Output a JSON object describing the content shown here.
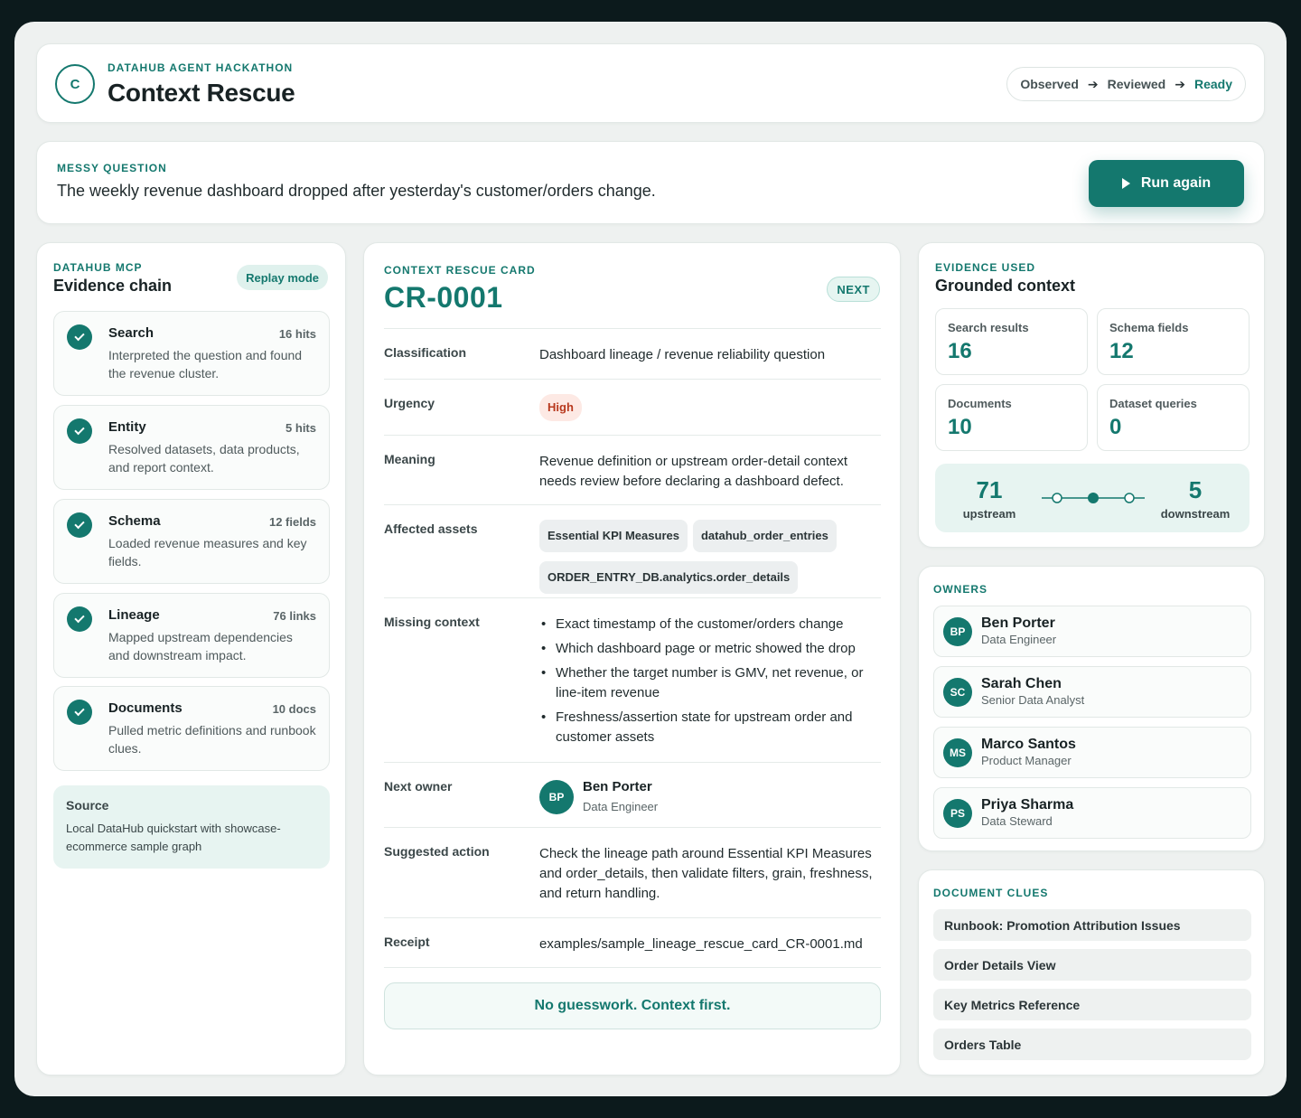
{
  "header": {
    "logo_letter": "C",
    "eyebrow": "DATAHUB AGENT HACKATHON",
    "title": "Context Rescue",
    "steps": [
      "Observed",
      "Reviewed",
      "Ready"
    ]
  },
  "question": {
    "eyebrow": "MESSY QUESTION",
    "text": "The weekly revenue dashboard dropped after yesterday's customer/orders change.",
    "run_label": "Run again"
  },
  "evidence_chain": {
    "eyebrow": "DATAHUB MCP",
    "title": "Evidence chain",
    "mode_label": "Replay mode",
    "items": [
      {
        "name": "Search",
        "count": "16 hits",
        "desc": "Interpreted the question and found the revenue cluster."
      },
      {
        "name": "Entity",
        "count": "5 hits",
        "desc": "Resolved datasets, data products, and report context."
      },
      {
        "name": "Schema",
        "count": "12 fields",
        "desc": "Loaded revenue measures and key fields."
      },
      {
        "name": "Lineage",
        "count": "76 links",
        "desc": "Mapped upstream dependencies and downstream impact."
      },
      {
        "name": "Documents",
        "count": "10 docs",
        "desc": "Pulled metric definitions and runbook clues."
      }
    ],
    "source_title": "Source",
    "source_text": "Local DataHub quickstart with showcase-ecommerce sample graph"
  },
  "rescue_card": {
    "eyebrow": "CONTEXT RESCUE CARD",
    "id": "CR-0001",
    "badge": "NEXT",
    "classification_label": "Classification",
    "classification": "Dashboard lineage / revenue reliability question",
    "urgency_label": "Urgency",
    "urgency": "High",
    "meaning_label": "Meaning",
    "meaning": "Revenue definition or upstream order-detail context needs review before declaring a dashboard defect.",
    "assets_label": "Affected assets",
    "assets": [
      "Essential KPI Measures",
      "datahub_order_entries",
      "ORDER_ENTRY_DB.analytics.order_details"
    ],
    "missing_label": "Missing context",
    "missing": [
      "Exact timestamp of the customer/orders change",
      "Which dashboard page or metric showed the drop",
      "Whether the target number is GMV, net revenue, or line-item revenue",
      "Freshness/assertion state for upstream order and customer assets"
    ],
    "owner_label": "Next owner",
    "owner": {
      "initials": "BP",
      "name": "Ben Porter",
      "role": "Data Engineer"
    },
    "action_label": "Suggested action",
    "action": "Check the lineage path around Essential KPI Measures and order_details, then validate filters, grain, freshness, and return handling.",
    "receipt_label": "Receipt",
    "receipt": "examples/sample_lineage_rescue_card_CR-0001.md",
    "banner": "No guesswork. Context first."
  },
  "evidence_used": {
    "eyebrow": "EVIDENCE USED",
    "title": "Grounded context",
    "stats": [
      {
        "label": "Search results",
        "value": "16"
      },
      {
        "label": "Schema fields",
        "value": "12"
      },
      {
        "label": "Documents",
        "value": "10"
      },
      {
        "label": "Dataset queries",
        "value": "0"
      }
    ],
    "upstream_value": "71",
    "upstream_label": "upstream",
    "downstream_value": "5",
    "downstream_label": "downstream"
  },
  "owners": {
    "eyebrow": "OWNERS",
    "list": [
      {
        "initials": "BP",
        "name": "Ben Porter",
        "role": "Data Engineer"
      },
      {
        "initials": "SC",
        "name": "Sarah Chen",
        "role": "Senior Data Analyst"
      },
      {
        "initials": "MS",
        "name": "Marco Santos",
        "role": "Product Manager"
      },
      {
        "initials": "PS",
        "name": "Priya Sharma",
        "role": "Data Steward"
      }
    ]
  },
  "document_clues": {
    "eyebrow": "DOCUMENT CLUES",
    "items": [
      "Runbook: Promotion Attribution Issues",
      "Order Details View",
      "Key Metrics Reference",
      "Orders Table"
    ]
  },
  "colors": {
    "accent": "#14786e",
    "urgency_high": "#b8391e",
    "background": "#0c1a1c"
  }
}
